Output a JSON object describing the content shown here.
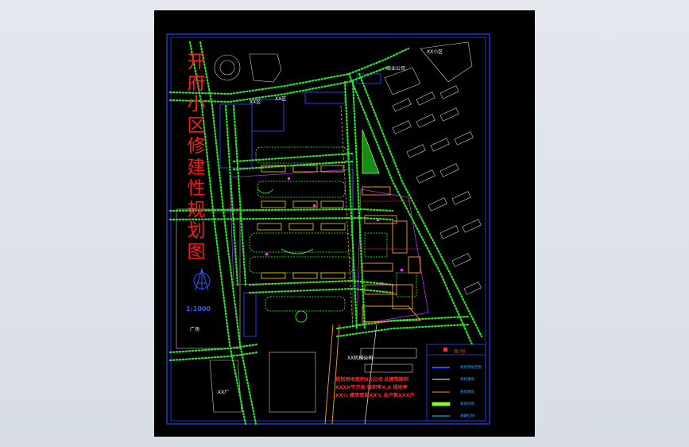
{
  "title_chars": [
    "开",
    "府",
    "小",
    "区",
    "修",
    "建",
    "性",
    "规",
    "划",
    "图"
  ],
  "scale": "1:1000",
  "labels": {
    "top_right": "XX小区",
    "top_mid": "商业公司",
    "plaza": "广场",
    "factory": "XX机械公司",
    "left_block": "XX厂",
    "top_left_a": "XX区",
    "top_left_b": "XX区"
  },
  "note": "规划用地面积XX公顷 总建筑面积XXXX平方米 容积率X.X 绿地率XX% 建筑密度XX% 总户数XXX户",
  "legend": {
    "title": "图 例",
    "items": [
      {
        "label": "规划用地范围",
        "color": "#2a46ff"
      },
      {
        "label": "现状建筑",
        "color": "#ffffff"
      },
      {
        "label": "规划建筑",
        "color": "#ff9a2a"
      },
      {
        "label": "规划绿地",
        "color": "#7dff2a"
      },
      {
        "label": "道路红线",
        "color": "#00e0ff"
      }
    ]
  },
  "colors": {
    "background": "#000000",
    "frame": "#2a46ff",
    "road_green": "#26e626",
    "title_red": "#ff1a1a"
  }
}
